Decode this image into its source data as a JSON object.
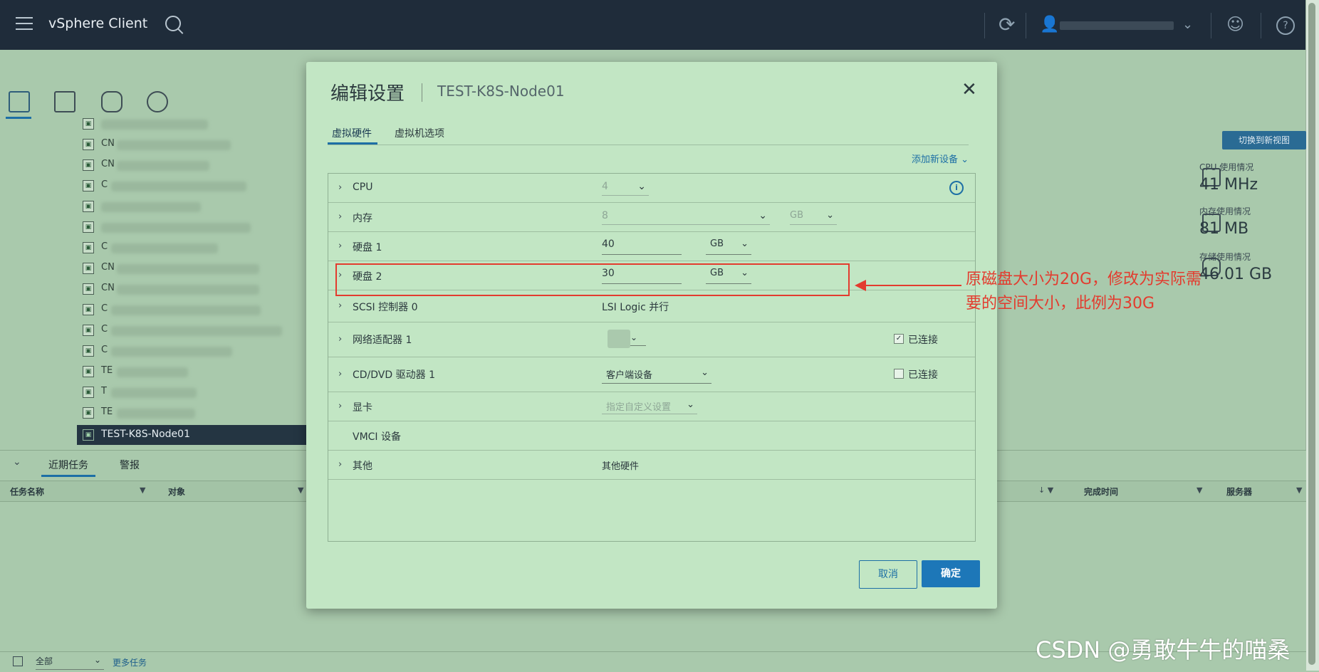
{
  "app": {
    "title": "vSphere Client"
  },
  "sidebar": {
    "selected_vm": "TEST-K8S-Node01",
    "tree_prefixes": [
      "",
      "CN",
      "CN",
      "C",
      "",
      "",
      "C",
      "CN",
      "CN",
      "C",
      "C",
      "C",
      "TE",
      "T",
      "TE"
    ]
  },
  "bottom_panel": {
    "tabs": [
      "近期任务",
      "警报"
    ],
    "columns": {
      "task_name": "任务名称",
      "object": "对象",
      "completion_time": "完成时间",
      "server": "服务器"
    },
    "filter_value": "全部",
    "more_tasks": "更多任务"
  },
  "right_panel": {
    "switch_button": "切换到新视图",
    "cpu": {
      "label": "CPU 使用情况",
      "value": "41 MHz"
    },
    "memory": {
      "label": "内存使用情况",
      "value": "81 MB"
    },
    "storage": {
      "label": "存储使用情况",
      "value": "46.01 GB"
    }
  },
  "modal": {
    "title": "编辑设置",
    "subtitle": "TEST-K8S-Node01",
    "tabs": [
      "虚拟硬件",
      "虚拟机选项"
    ],
    "add_device": "添加新设备 ⌄",
    "rows": {
      "cpu": {
        "name": "CPU",
        "value": "4"
      },
      "memory": {
        "name": "内存",
        "value": "8",
        "unit": "GB"
      },
      "disk1": {
        "name": "硬盘 1",
        "value": "40",
        "unit": "GB"
      },
      "disk2": {
        "name": "硬盘 2",
        "value": "30",
        "unit": "GB"
      },
      "scsi": {
        "name": "SCSI 控制器 0",
        "value": "LSI Logic 并行"
      },
      "network": {
        "name": "网络适配器 1",
        "connected_label": "已连接",
        "connected": true
      },
      "cddvd": {
        "name": "CD/DVD 驱动器 1",
        "value": "客户端设备",
        "connected_label": "已连接",
        "connected": false
      },
      "video": {
        "name": "显卡",
        "value": "指定自定义设置"
      },
      "vmci": {
        "name": "VMCI 设备"
      },
      "other": {
        "name": "其他",
        "value": "其他硬件"
      }
    },
    "cancel_label": "取消",
    "ok_label": "确定"
  },
  "annotation": {
    "text": "原磁盘大小为20G，修改为实际需要的空间大小，此例为30G",
    "color": "#e33b2e"
  },
  "watermark": "CSDN @勇敢牛牛的喵桑",
  "colors": {
    "topbar": "#1f2c3a",
    "accent": "#1d77b8",
    "modal_bg": "#c2e6c4"
  }
}
